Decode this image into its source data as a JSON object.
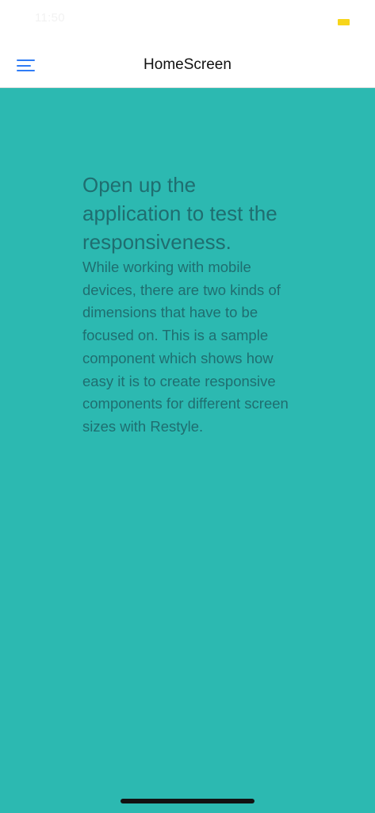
{
  "status_bar": {
    "time": "11:50",
    "battery_icon": "battery-icon",
    "battery_color": "#f7d51a"
  },
  "nav": {
    "title": "HomeScreen",
    "menu_icon": "hamburger-menu-icon",
    "accent_color": "#2f7cf6"
  },
  "content": {
    "background_color": "#2cb9b1",
    "heading": "Open up the application to test the responsiveness.",
    "body": "While working with mobile devices, there are two kinds of dimensions that have to be focused on. This is a sample component which shows how easy it is to create responsive components for different screen sizes with Restyle."
  }
}
